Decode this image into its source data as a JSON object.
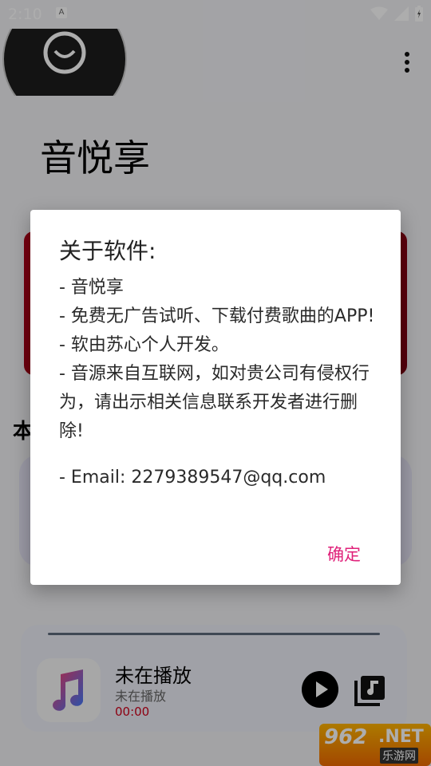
{
  "status_bar": {
    "time": "2:10",
    "notification_icon": "A"
  },
  "app": {
    "title": "音悦享",
    "section_char": "本"
  },
  "player": {
    "title": "未在播放",
    "subtitle": "未在播放",
    "time": "00:00",
    "accent": "#d0021b"
  },
  "dialog": {
    "title": "关于软件:",
    "lines": [
      " - 音悦享",
      " - 免费无广告试听、下载付费歌曲的APP!",
      " - 软由苏心个人开发。",
      " - 音源来自互联网，如对贵公司有侵权行为，请出示相关信息联系开发者进行删除!",
      " - Email: 2279389547@qq.com"
    ],
    "confirm_label": "确定",
    "confirm_color": "#e0217a"
  },
  "watermark": {
    "number": "962",
    "suffix": ".NET",
    "site": "乐游网"
  }
}
